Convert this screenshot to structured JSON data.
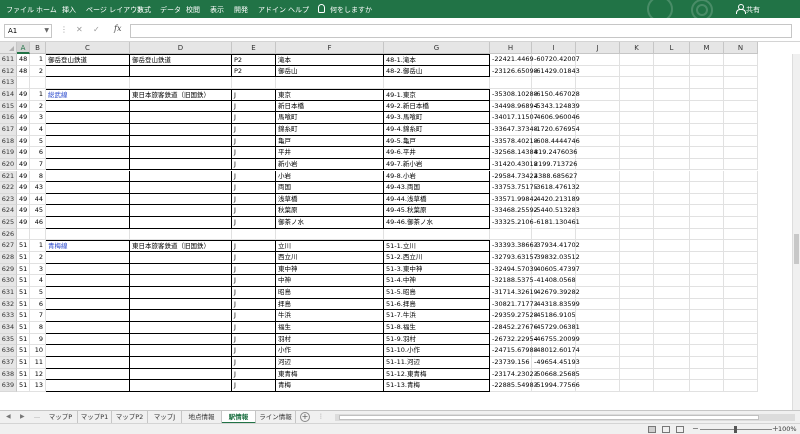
{
  "ribbon": {
    "tabs": [
      "ファイル",
      "ホーム",
      "挿入",
      "ページ レイアウト",
      "数式",
      "データ",
      "校閲",
      "表示",
      "開発",
      "アドイン",
      "ヘルプ"
    ],
    "search": "何をしますか",
    "user": "共有"
  },
  "formula_bar": {
    "name_box": "A1",
    "formula": ""
  },
  "columns": [
    "A",
    "B",
    "C",
    "D",
    "E",
    "F",
    "G",
    "H",
    "I",
    "J",
    "K",
    "L",
    "M",
    "N"
  ],
  "rows": [
    {
      "n": "611",
      "a": "48",
      "b": "1",
      "c": "御岳登山鉄道",
      "d": "御岳登山鉄道",
      "e": "P2",
      "f": "滝本",
      "g": "48-1.滝本",
      "h": "-22421.4469",
      "i": "-60720.42007"
    },
    {
      "n": "612",
      "a": "48",
      "b": "2",
      "c": "",
      "d": "",
      "e": "P2",
      "f": "御岳山",
      "g": "48-2.御岳山",
      "h": "-23126.65098",
      "i": "-61429.01843"
    },
    {
      "n": "613",
      "a": "",
      "b": "",
      "c": "",
      "d": "",
      "e": "",
      "f": "",
      "g": "",
      "h": "",
      "i": ""
    },
    {
      "n": "614",
      "a": "49",
      "b": "1",
      "c": "総武線",
      "d": "東日本旅客鉄道（旧国鉄）",
      "e": "J",
      "f": "東京",
      "g": "49-1.東京",
      "h": "-35308.10288",
      "i": "-6150.467028"
    },
    {
      "n": "615",
      "a": "49",
      "b": "2",
      "c": "",
      "d": "",
      "e": "J",
      "f": "新日本橋",
      "g": "49-2.新日本橋",
      "h": "-34498.96894",
      "i": "-5343.124839"
    },
    {
      "n": "616",
      "a": "49",
      "b": "3",
      "c": "",
      "d": "",
      "e": "J",
      "f": "馬喰町",
      "g": "49-3.馬喰町",
      "h": "-34017.11507",
      "i": "-4606.960046"
    },
    {
      "n": "617",
      "a": "49",
      "b": "4",
      "c": "",
      "d": "",
      "e": "J",
      "f": "錦糸町",
      "g": "49-4.錦糸町",
      "h": "-33647.37348",
      "i": "-1720.676954"
    },
    {
      "n": "618",
      "a": "49",
      "b": "5",
      "c": "",
      "d": "",
      "e": "J",
      "f": "亀戸",
      "g": "49-5.亀戸",
      "h": "-33578.40218",
      "i": "-608.4444746"
    },
    {
      "n": "619",
      "a": "49",
      "b": "6",
      "c": "",
      "d": "",
      "e": "J",
      "f": "平井",
      "g": "49-6.平井",
      "h": "-32568.14384",
      "i": "819.2476036"
    },
    {
      "n": "620",
      "a": "49",
      "b": "7",
      "c": "",
      "d": "",
      "e": "J",
      "f": "新小岩",
      "g": "49-7.新小岩",
      "h": "-31420.43018",
      "i": "2199.713726"
    },
    {
      "n": "621",
      "a": "49",
      "b": "8",
      "c": "",
      "d": "",
      "e": "J",
      "f": "小岩",
      "g": "49-8.小岩",
      "h": "-29584.73422",
      "i": "4388.685627"
    },
    {
      "n": "622",
      "a": "49",
      "b": "43",
      "c": "",
      "d": "",
      "e": "J",
      "f": "両国",
      "g": "49-43.両国",
      "h": "-33753.75175",
      "i": "-3618.476132"
    },
    {
      "n": "623",
      "a": "49",
      "b": "44",
      "c": "",
      "d": "",
      "e": "J",
      "f": "浅草橋",
      "g": "49-44.浅草橋",
      "h": "-33571.99842",
      "i": "-4420.213189"
    },
    {
      "n": "624",
      "a": "49",
      "b": "45",
      "c": "",
      "d": "",
      "e": "J",
      "f": "秋葉原",
      "g": "49-45.秋葉原",
      "h": "-33468.25592",
      "i": "-5440.513283"
    },
    {
      "n": "625",
      "a": "49",
      "b": "46",
      "c": "",
      "d": "",
      "e": "J",
      "f": "御茶ノ水",
      "g": "49-46.御茶ノ水",
      "h": "-33325.2106",
      "i": "-6181.130461"
    },
    {
      "n": "626",
      "a": "",
      "b": "",
      "c": "",
      "d": "",
      "e": "",
      "f": "",
      "g": "",
      "h": "",
      "i": ""
    },
    {
      "n": "627",
      "a": "51",
      "b": "1",
      "c": "青梅線",
      "d": "東日本旅客鉄道（旧国鉄）",
      "e": "J",
      "f": "立川",
      "g": "51-1.立川",
      "h": "-33393.38663",
      "i": "-37934.41702"
    },
    {
      "n": "628",
      "a": "51",
      "b": "2",
      "c": "",
      "d": "",
      "e": "J",
      "f": "西立川",
      "g": "51-2.西立川",
      "h": "-32793.63157",
      "i": "-39832.03512"
    },
    {
      "n": "629",
      "a": "51",
      "b": "3",
      "c": "",
      "d": "",
      "e": "J",
      "f": "東中神",
      "g": "51-3.東中神",
      "h": "-32494.57039",
      "i": "-40605.47397"
    },
    {
      "n": "630",
      "a": "51",
      "b": "4",
      "c": "",
      "d": "",
      "e": "J",
      "f": "中神",
      "g": "51-4.中神",
      "h": "-32188.5375",
      "i": "-41408.0568"
    },
    {
      "n": "631",
      "a": "51",
      "b": "5",
      "c": "",
      "d": "",
      "e": "J",
      "f": "昭島",
      "g": "51-5.昭島",
      "h": "-31714.32619",
      "i": "-42679.39282"
    },
    {
      "n": "632",
      "a": "51",
      "b": "6",
      "c": "",
      "d": "",
      "e": "J",
      "f": "拝島",
      "g": "51-6.拝島",
      "h": "-30821.71773",
      "i": "-44318.83599"
    },
    {
      "n": "633",
      "a": "51",
      "b": "7",
      "c": "",
      "d": "",
      "e": "J",
      "f": "牛浜",
      "g": "51-7.牛浜",
      "h": "-29359.27528",
      "i": "-45186.9105"
    },
    {
      "n": "634",
      "a": "51",
      "b": "8",
      "c": "",
      "d": "",
      "e": "J",
      "f": "福生",
      "g": "51-8.福生",
      "h": "-28452.27676",
      "i": "-45729.06381"
    },
    {
      "n": "635",
      "a": "51",
      "b": "9",
      "c": "",
      "d": "",
      "e": "J",
      "f": "羽村",
      "g": "51-9.羽村",
      "h": "-26732.22954",
      "i": "-46755.20099"
    },
    {
      "n": "636",
      "a": "51",
      "b": "10",
      "c": "",
      "d": "",
      "e": "J",
      "f": "小作",
      "g": "51-10.小作",
      "h": "-24715.67988",
      "i": "-48012.60174"
    },
    {
      "n": "637",
      "a": "51",
      "b": "11",
      "c": "",
      "d": "",
      "e": "J",
      "f": "河辺",
      "g": "51-11.河辺",
      "h": "-23739.156",
      "i": "-49654.45193"
    },
    {
      "n": "638",
      "a": "51",
      "b": "12",
      "c": "",
      "d": "",
      "e": "J",
      "f": "東青梅",
      "g": "51-12.東青梅",
      "h": "-23174.23023",
      "i": "-50668.25685"
    },
    {
      "n": "639",
      "a": "51",
      "b": "13",
      "c": "",
      "d": "",
      "e": "J",
      "f": "青梅",
      "g": "51-13.青梅",
      "h": "-22885.54983",
      "i": "-51994.77566"
    }
  ],
  "sheet_tabs": [
    "マップP",
    "マップP1",
    "マップP2",
    "マップJ",
    "地点情報",
    "駅情報",
    "ライン情報"
  ],
  "active_sheet": "駅情報",
  "status": {
    "zoom": "100%"
  },
  "colors": {
    "ribbon": "#217346",
    "link": "#2646cc"
  }
}
